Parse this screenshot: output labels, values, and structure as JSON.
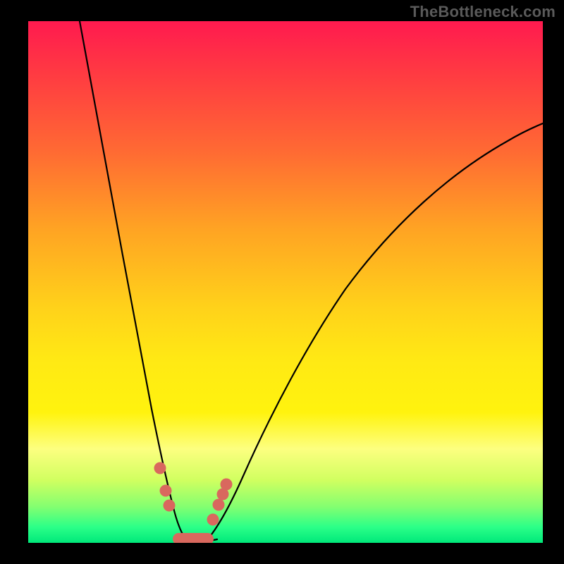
{
  "watermark": "TheBottleneck.com",
  "colors": {
    "background": "#000000",
    "gradient_top": "#ff1a4f",
    "gradient_bottom": "#00e87a",
    "curve": "#000000",
    "marker": "#d9685e"
  },
  "chart_data": {
    "type": "line",
    "title": "",
    "xlabel": "",
    "ylabel": "",
    "xlim": [
      0,
      100
    ],
    "ylim": [
      0,
      100
    ],
    "x_ticks": [],
    "y_ticks": [],
    "grid": false,
    "legend": false,
    "series": [
      {
        "name": "left-branch",
        "x": [
          10,
          12,
          14,
          16,
          18,
          20,
          22,
          24,
          25,
          26,
          27,
          28,
          29
        ],
        "y": [
          100,
          90,
          80,
          70,
          60,
          48,
          36,
          22,
          15,
          9,
          5,
          2,
          0
        ]
      },
      {
        "name": "right-branch",
        "x": [
          34,
          36,
          38,
          42,
          48,
          55,
          62,
          70,
          78,
          86,
          94,
          100
        ],
        "y": [
          0,
          4,
          9,
          18,
          30,
          42,
          52,
          61,
          68,
          74,
          78,
          81
        ]
      }
    ],
    "markers": [
      {
        "x": 25.2,
        "y": 14
      },
      {
        "x": 26.1,
        "y": 9
      },
      {
        "x": 26.7,
        "y": 6
      },
      {
        "x": 35.8,
        "y": 5
      },
      {
        "x": 36.8,
        "y": 8
      },
      {
        "x": 37.4,
        "y": 10
      },
      {
        "x": 38.0,
        "y": 12
      }
    ],
    "flat_segment": {
      "x_start": 28,
      "x_end": 34,
      "y": 0
    }
  }
}
